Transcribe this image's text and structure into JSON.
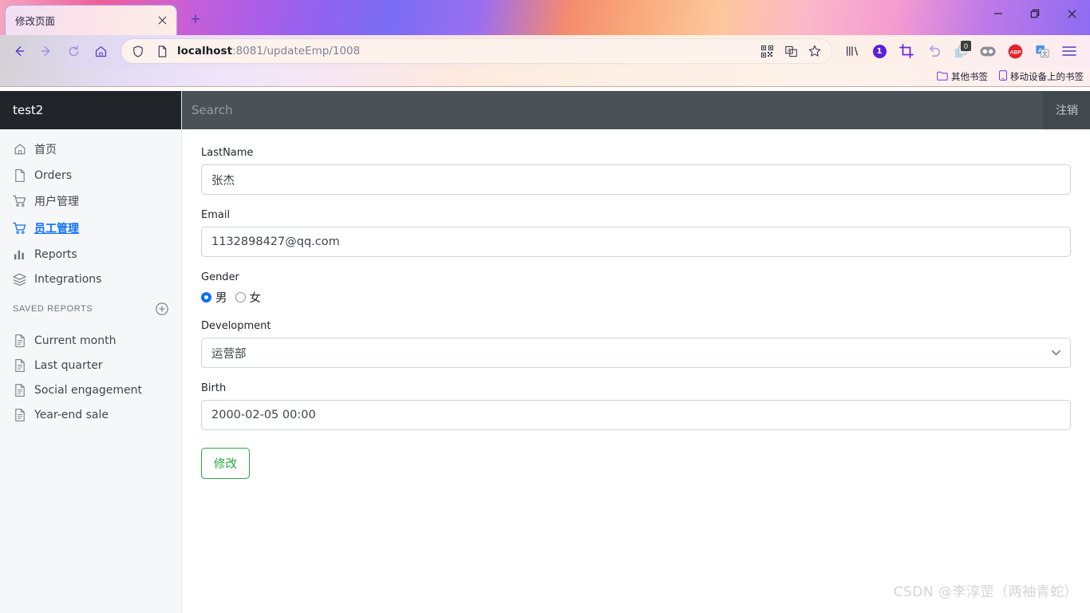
{
  "browser": {
    "tab": {
      "title": "修改页面",
      "close_icon": "close-icon"
    },
    "new_tab_label": "+",
    "window_controls": {
      "minimize": "—",
      "maximize": "▢",
      "close": "✕"
    },
    "nav": {
      "back": "←",
      "forward": "→",
      "reload": "⟳",
      "home": "⌂"
    },
    "url": {
      "host": "localhost",
      "path": ":8081/updateEmp/1008",
      "full": "localhost:8081/updateEmp/1008"
    },
    "address_icons": [
      "shield-icon",
      "page-icon",
      "qr-code-icon",
      "translate-icon",
      "favorite-star-icon"
    ],
    "toolbar_icons": [
      "collections-icon",
      "profile-badge-icon",
      "screenshot-icon",
      "undo-icon",
      "clipboard-icon",
      "toggle-icon",
      "adblock-icon",
      "translate-extension-icon",
      "menu-icon"
    ],
    "toolbar_badges": {
      "profile": "1",
      "clipboard": "0",
      "adblock": "ABP"
    },
    "bookmarks": [
      {
        "label": "其他书签",
        "icon": "folder-icon"
      },
      {
        "label": "移动设备上的书签",
        "icon": "mobile-icon"
      }
    ]
  },
  "sidebar": {
    "brand": "test2",
    "items": [
      {
        "label": "首页",
        "icon": "home-icon",
        "active": false
      },
      {
        "label": "Orders",
        "icon": "file-icon",
        "active": false
      },
      {
        "label": "用户管理",
        "icon": "cart-icon",
        "active": false
      },
      {
        "label": "员工管理",
        "icon": "cart-icon",
        "active": true
      },
      {
        "label": "Reports",
        "icon": "bar-chart-icon",
        "active": false
      },
      {
        "label": "Integrations",
        "icon": "layers-icon",
        "active": false
      }
    ],
    "saved_reports": {
      "title": "SAVED REPORTS",
      "add_icon": "plus-circle-icon",
      "items": [
        {
          "label": "Current month",
          "icon": "document-icon"
        },
        {
          "label": "Last quarter",
          "icon": "document-icon"
        },
        {
          "label": "Social engagement",
          "icon": "document-icon"
        },
        {
          "label": "Year-end sale",
          "icon": "document-icon"
        }
      ]
    }
  },
  "topnav": {
    "search_placeholder": "Search",
    "logout_label": "注销"
  },
  "form": {
    "lastname": {
      "label": "LastName",
      "value": "张杰"
    },
    "email": {
      "label": "Email",
      "value": "1132898427@qq.com"
    },
    "gender": {
      "label": "Gender",
      "options": [
        {
          "label": "男",
          "checked": true
        },
        {
          "label": "女",
          "checked": false
        }
      ]
    },
    "development": {
      "label": "Development",
      "value": "运营部",
      "chevron": "chevron-down-icon"
    },
    "birth": {
      "label": "Birth",
      "value": "2000-02-05 00:00"
    },
    "submit_label": "修改"
  },
  "watermark": "CSDN @李淳罡（两袖青蛇）",
  "colors": {
    "accent_blue": "#0d6efd",
    "brand_dark": "#212529",
    "topnav": "#4a5157",
    "sidebar_bg": "#f6f7f9",
    "submit_green": "#2aa745",
    "adblock_red": "#e0232e"
  }
}
